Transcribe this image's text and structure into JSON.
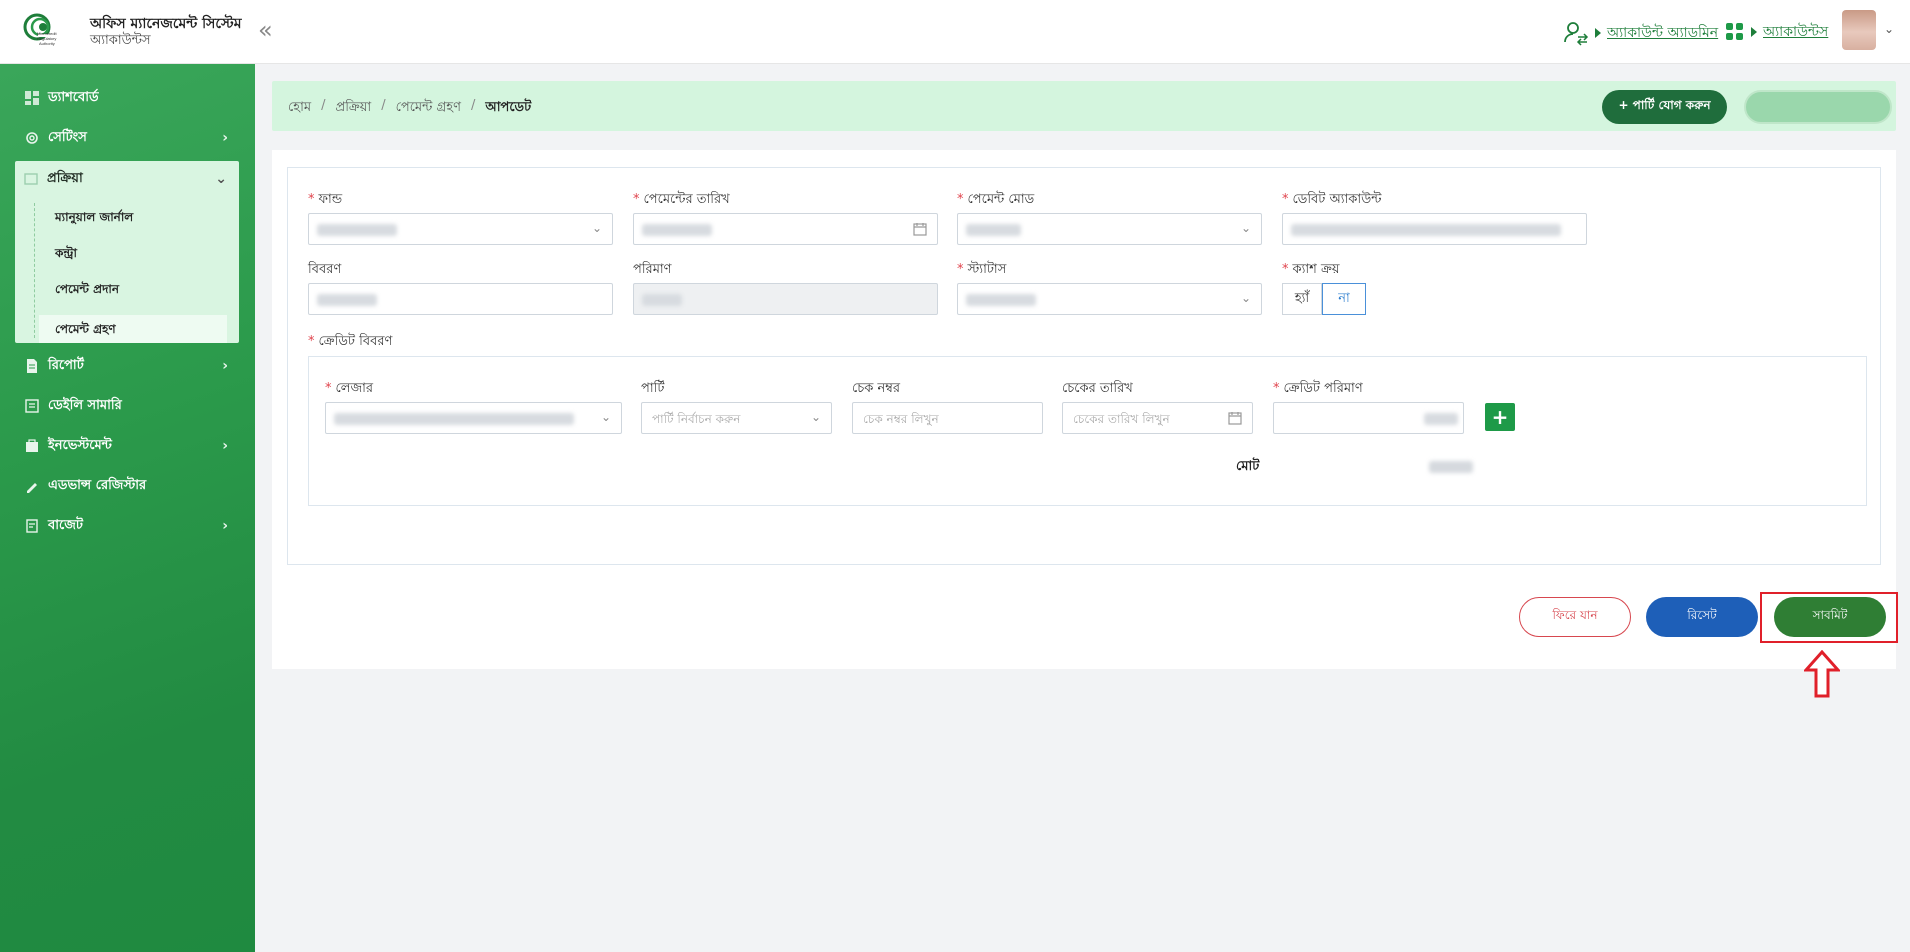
{
  "header": {
    "app_title": "অফিস ম্যানেজমেন্ট সিস্টেম",
    "app_subtitle": "অ্যাকাউন্টস",
    "logo_text": "Microcredit Regulatory Authority",
    "role_admin": "অ্যাকাউন্ট অ্যাডমিন",
    "role_module": "অ্যাকাউন্টস"
  },
  "sidebar": {
    "items": [
      {
        "label": "ড্যাশবোর্ড",
        "icon": "dashboard-icon"
      },
      {
        "label": "সেটিংস",
        "icon": "gear-icon"
      },
      {
        "label": "প্রক্রিয়া",
        "icon": "process-icon"
      },
      {
        "label": "রিপোর্ট",
        "icon": "document-icon"
      },
      {
        "label": "ডেইলি সামারি",
        "icon": "summary-icon"
      },
      {
        "label": "ইনভেস্টমেন্ট",
        "icon": "investment-icon"
      },
      {
        "label": "এডভান্স রেজিস্টার",
        "icon": "register-icon"
      },
      {
        "label": "বাজেট",
        "icon": "budget-icon"
      }
    ],
    "sub_items": [
      {
        "label": "ম্যানুয়াল জার্নাল"
      },
      {
        "label": "কন্ট্রা"
      },
      {
        "label": "পেমেন্ট প্রদান"
      },
      {
        "label": "পেমেন্ট গ্রহণ"
      }
    ]
  },
  "breadcrumb": {
    "home": "হোম",
    "process": "প্রক্রিয়া",
    "payment_receive": "পেমেন্ট গ্রহণ",
    "current": "আপডেট",
    "separator": "/"
  },
  "actions": {
    "add_party": "+ পার্টি যোগ করুন"
  },
  "form": {
    "fund_label": "ফান্ড",
    "payment_date_label": "পেমেন্টের তারিখ",
    "payment_mode_label": "পেমেন্ট মোড",
    "debit_account_label": "ডেবিট অ্যাকাউন্ট",
    "description_label": "বিবরণ",
    "amount_label": "পরিমাণ",
    "status_label": "স্ট্যাটাস",
    "cash_purchase_label": "ক্যাশ ক্রয়",
    "cash_yes": "হ্যাঁ",
    "cash_no": "না",
    "credit_details_label": "ক্রেডিট বিবরণ"
  },
  "credit": {
    "ledger_label": "লেজার",
    "party_label": "পার্টি",
    "party_placeholder": "পার্টি নির্বাচন করুন",
    "cheque_no_label": "চেক নম্বর",
    "cheque_no_placeholder": "চেক নম্বর লিখুন",
    "cheque_date_label": "চেকের তারিখ",
    "cheque_date_placeholder": "চেকের তারিখ লিখুন",
    "credit_amount_label": "ক্রেডিট পরিমাণ",
    "total_label": "মোট",
    "add_symbol": "+"
  },
  "buttons": {
    "back": "ফিরে যান",
    "reset": "রিসেট",
    "submit": "সাবমিট"
  },
  "colors": {
    "brand_green": "#2b9a4b",
    "crumb_bg": "#d4f5de",
    "submit_green": "#2f7e34",
    "reset_blue": "#1e5fb8",
    "back_red": "#d7474f",
    "highlight_red": "#e0202a"
  }
}
